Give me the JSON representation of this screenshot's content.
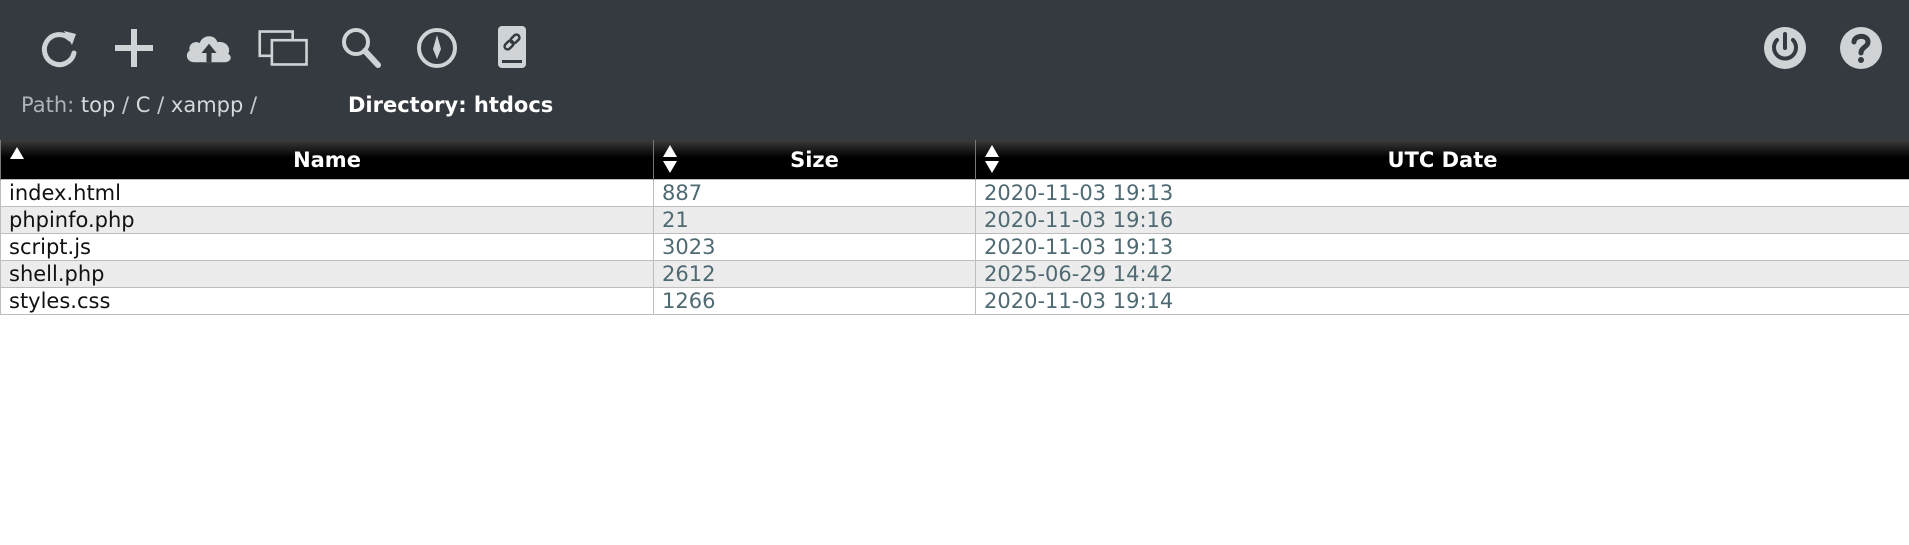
{
  "toolbar": {
    "left_buttons": [
      {
        "icon": "refresh-icon"
      },
      {
        "icon": "plus-icon"
      },
      {
        "icon": "cloud-upload-icon"
      },
      {
        "icon": "windows-icon"
      },
      {
        "icon": "search-icon"
      },
      {
        "icon": "compass-icon"
      },
      {
        "icon": "link-drive-icon"
      }
    ],
    "right_buttons": [
      {
        "icon": "power-icon"
      },
      {
        "icon": "help-icon"
      }
    ],
    "icon_color": "#cfd3d6"
  },
  "path": {
    "label": "Path:",
    "segments": [
      "top",
      "C",
      "xampp"
    ],
    "separator": "/"
  },
  "directory": {
    "text": "Directory: htdocs"
  },
  "table": {
    "columns": [
      "Name",
      "Size",
      "UTC Date"
    ],
    "rows": [
      {
        "name": "index.html",
        "size": "887",
        "date": "2020-11-03 19:13"
      },
      {
        "name": "phpinfo.php",
        "size": "21",
        "date": "2020-11-03 19:16"
      },
      {
        "name": "script.js",
        "size": "3023",
        "date": "2020-11-03 19:13"
      },
      {
        "name": "shell.php",
        "size": "2612",
        "date": "2025-06-29 14:42"
      },
      {
        "name": "styles.css",
        "size": "1266",
        "date": "2020-11-03 19:14"
      }
    ]
  },
  "colors": {
    "topbar_bg": "#343a40",
    "header_bg": "#000000",
    "row_alt": "#ececec",
    "value_text": "#4f6a72"
  }
}
